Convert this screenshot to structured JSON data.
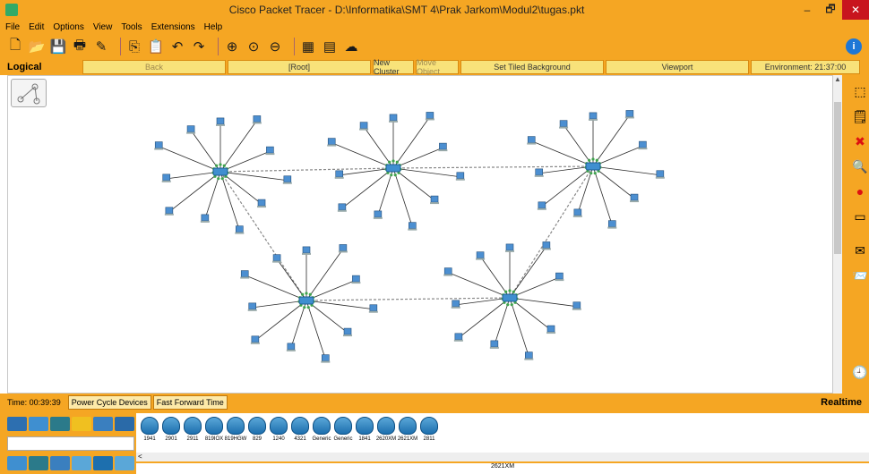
{
  "window": {
    "title": "Cisco Packet Tracer - D:\\Informatika\\SMT 4\\Prak Jarkom\\Modul2\\tugas.pkt",
    "minimize": "–",
    "restore": "🗗",
    "close": "✕"
  },
  "menu": [
    "File",
    "Edit",
    "Options",
    "View",
    "Tools",
    "Extensions",
    "Help"
  ],
  "toolbar": {
    "info": "i",
    "icons": [
      "new-icon",
      "open-icon",
      "save-icon",
      "print-icon",
      "activity-wizard-icon",
      "copy-icon",
      "paste-icon",
      "undo-icon",
      "redo-icon",
      "zoom-in-icon",
      "zoom-reset-icon",
      "zoom-out-icon",
      "palette-icon",
      "custom-device-icon",
      "cloud-icon"
    ]
  },
  "logical_bar": {
    "logical": "Logical",
    "back": "Back",
    "root": "[Root]",
    "new_cluster": "New Cluster",
    "move_object": "Move Object",
    "set_tiled_background": "Set Tiled Background",
    "viewport": "Viewport",
    "environment": "Environment: 21:37:00"
  },
  "status": {
    "time": "Time: 00:39:39",
    "power_cycle": "Power Cycle Devices",
    "fast_forward": "Fast Forward Time",
    "realtime": "Realtime"
  },
  "devices": [
    "1941",
    "2901",
    "2911",
    "819IOX",
    "819HGW",
    "829",
    "1240",
    "4321",
    "Generic",
    "Generic",
    "1841",
    "2620XM",
    "2621XM",
    "2811"
  ],
  "selected_device": "2621XM",
  "colors": {
    "accent": "#f5a623",
    "link_dashed": "#888888",
    "link_solid": "#2a2a2a",
    "pc_green": "#3fa34d"
  }
}
